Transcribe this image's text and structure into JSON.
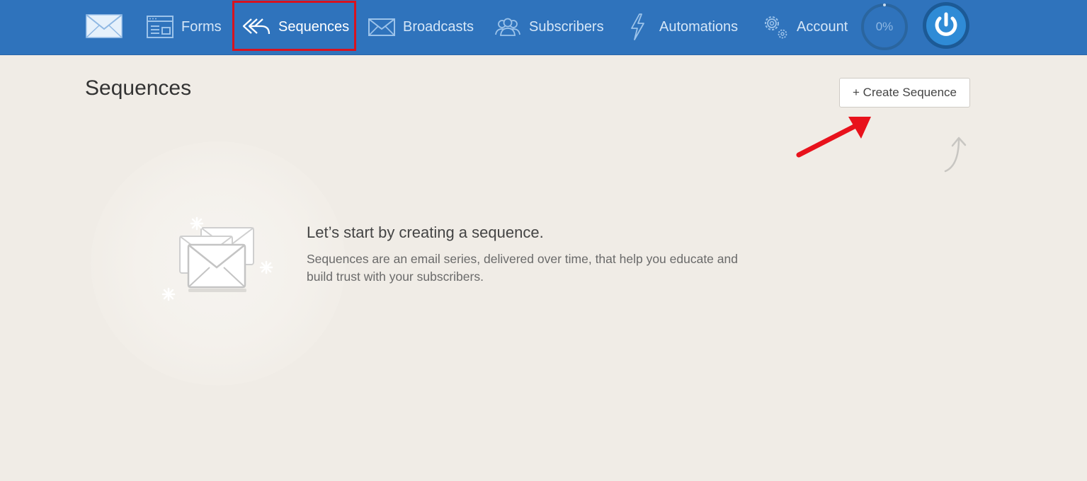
{
  "nav": {
    "items": [
      {
        "label": "Forms",
        "icon": "forms-icon"
      },
      {
        "label": "Sequences",
        "icon": "sequences-icon",
        "active": true
      },
      {
        "label": "Broadcasts",
        "icon": "envelope-icon"
      },
      {
        "label": "Subscribers",
        "icon": "subscribers-icon"
      },
      {
        "label": "Automations",
        "icon": "lightning-icon"
      },
      {
        "label": "Account",
        "icon": "gear-icon"
      }
    ],
    "progress": "0%",
    "progress_fraction": 0
  },
  "main": {
    "title": "Sequences",
    "create_button": "+ Create Sequence",
    "empty_title": "Let’s start by creating a sequence.",
    "empty_description": "Sequences are an email series, delivered over time, that help you educate and build trust with your subscribers."
  },
  "colors": {
    "topbar": "#2f73bc",
    "background": "#f0ece6",
    "highlight": "#d8121f",
    "annotation_arrow": "#e8121c"
  }
}
